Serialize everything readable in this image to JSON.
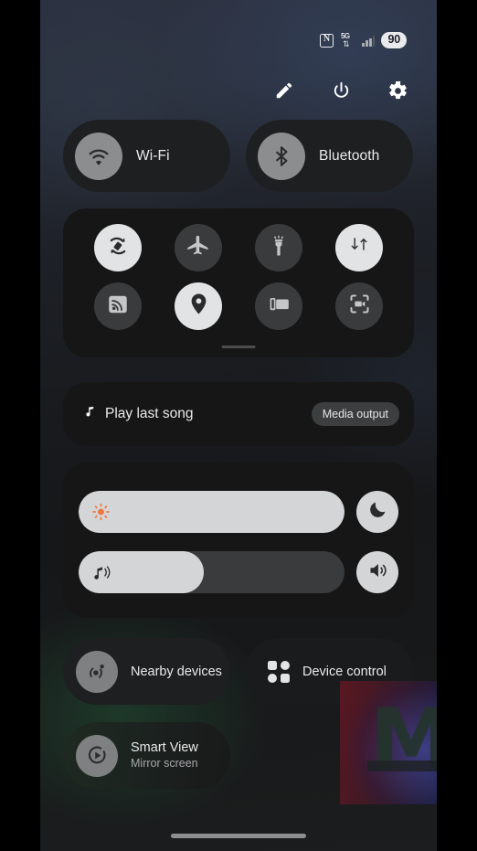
{
  "statusbar": {
    "nfc_icon": "nfc-icon",
    "network_label": "5G",
    "signal_icon": "signal-bars-icon",
    "battery_level": "90"
  },
  "header": {
    "edit_icon": "pencil-edit-icon",
    "power_icon": "power-icon",
    "settings_icon": "gear-settings-icon"
  },
  "connectivity": [
    {
      "label": "Wi-Fi",
      "icon": "wifi-icon",
      "state": "off"
    },
    {
      "label": "Bluetooth",
      "icon": "bluetooth-icon",
      "state": "off"
    }
  ],
  "quick_toggles": {
    "row1": [
      {
        "name": "auto-rotate",
        "icon": "auto-rotate-icon",
        "state": "on"
      },
      {
        "name": "airplane-mode",
        "icon": "airplane-icon",
        "state": "off"
      },
      {
        "name": "flashlight",
        "icon": "flashlight-icon",
        "state": "off"
      },
      {
        "name": "mobile-data",
        "icon": "mobile-data-icon",
        "state": "on"
      }
    ],
    "row2": [
      {
        "name": "smart-view-cast",
        "icon": "cast-icon",
        "state": "off"
      },
      {
        "name": "location",
        "icon": "location-pin-icon",
        "state": "on"
      },
      {
        "name": "multi-window",
        "icon": "multi-window-icon",
        "state": "off"
      },
      {
        "name": "screen-recorder",
        "icon": "screen-record-icon",
        "state": "off"
      }
    ],
    "drag_handle": "panel-drag-handle"
  },
  "media": {
    "note_icon": "music-note-icon",
    "title": "Play last song",
    "output_button": "Media output"
  },
  "sliders": {
    "brightness": {
      "icon": "brightness-sun-icon",
      "value": 100,
      "fill_percent": "100%",
      "button_icon": "moon-dark-mode-icon",
      "button_state": "on"
    },
    "volume": {
      "icon": "media-volume-icon",
      "value": 47,
      "fill_percent": "47%",
      "button_icon": "speaker-icon",
      "button_state": "on"
    }
  },
  "shortcuts": [
    {
      "name": "nearby-devices",
      "title": "Nearby devices",
      "subtitle": "",
      "icon": "nearby-share-icon"
    },
    {
      "name": "device-control",
      "title": "Device control",
      "subtitle": "",
      "icon": "device-grid-icon"
    },
    {
      "name": "smart-view",
      "title": "Smart View",
      "subtitle": "Mirror screen",
      "icon": "smart-view-play-icon"
    }
  ],
  "navigation": {
    "home_indicator": "home-indicator"
  },
  "watermark": {
    "letter": "M"
  },
  "colors": {
    "accent_on": "#e2e3e4",
    "toggle_off": "#3a3b3c",
    "panel_bg": "#161616",
    "pill_bg": "#1e1f20",
    "text_primary": "#e9eaeb",
    "text_secondary": "#a7a9ab",
    "brightness_icon": "#f2763b"
  }
}
